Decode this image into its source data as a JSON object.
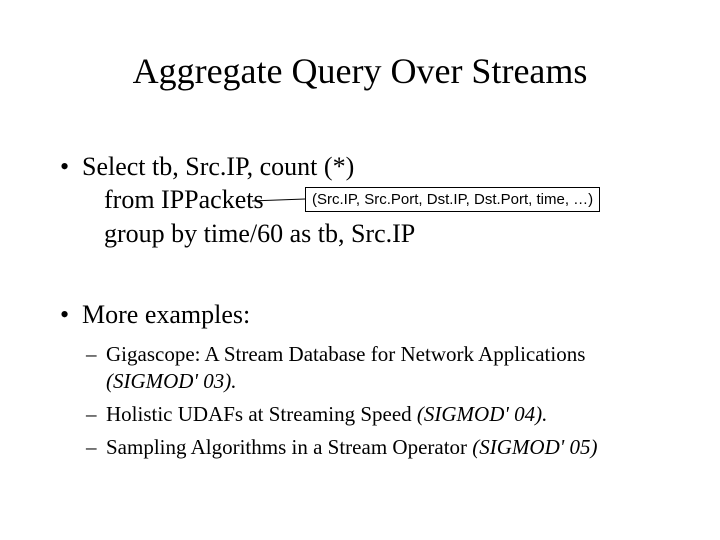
{
  "title": "Aggregate Query Over Streams",
  "bullet1": {
    "line1": "Select tb, Src.IP, count (*)",
    "line2": "from IPPackets",
    "line3": "group by time/60 as tb, Src.IP"
  },
  "callout": "(Src.IP, Src.Port, Dst.IP, Dst.Port, time, …)",
  "bullet2": "More examples:",
  "subitems": [
    {
      "plain": "Gigascope: A Stream Database for Network Applications ",
      "italic": "(SIGMOD' 03)."
    },
    {
      "plain": "Holistic UDAFs at Streaming Speed ",
      "italic": "(SIGMOD' 04)."
    },
    {
      "plain": "Sampling Algorithms in a Stream Operator ",
      "italic": "(SIGMOD' 05)"
    }
  ],
  "glyphs": {
    "bullet": "•",
    "dash": "–"
  }
}
